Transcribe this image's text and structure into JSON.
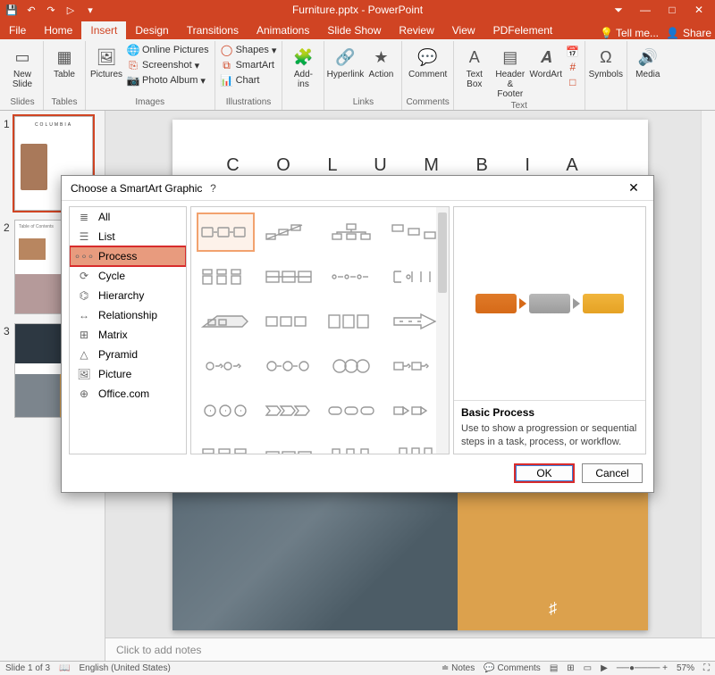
{
  "app": {
    "title": "Furniture.pptx - PowerPoint"
  },
  "tabs": {
    "file": "File",
    "home": "Home",
    "insert": "Insert",
    "design": "Design",
    "transitions": "Transitions",
    "animations": "Animations",
    "slideshow": "Slide Show",
    "review": "Review",
    "view": "View",
    "pdfelement": "PDFelement",
    "tellme": "Tell me...",
    "share": "Share"
  },
  "ribbon": {
    "newslide": "New\nSlide",
    "slides": "Slides",
    "table": "Table",
    "tables": "Tables",
    "pictures": "Pictures",
    "onlinepics": "Online Pictures",
    "screenshot": "Screenshot",
    "photoalbum": "Photo Album",
    "images": "Images",
    "shapes": "Shapes",
    "smartart": "SmartArt",
    "chart": "Chart",
    "illustrations": "Illustrations",
    "addins": "Add-\nins",
    "hyperlink": "Hyperlink",
    "action": "Action",
    "links": "Links",
    "comment": "Comment",
    "comments": "Comments",
    "textbox": "Text\nBox",
    "headerfooter": "Header\n& Footer",
    "wordart": "WordArt",
    "text": "Text",
    "symbols": "Symbols",
    "media": "Media"
  },
  "thumbnails": {
    "n1": "1",
    "n2": "2",
    "n3": "3"
  },
  "slide": {
    "title": "C O L U M B I A"
  },
  "notes": {
    "placeholder": "Click to add notes"
  },
  "dialog": {
    "title": "Choose a SmartArt Graphic",
    "categories": {
      "all": "All",
      "list": "List",
      "process": "Process",
      "cycle": "Cycle",
      "hierarchy": "Hierarchy",
      "relationship": "Relationship",
      "matrix": "Matrix",
      "pyramid": "Pyramid",
      "picture": "Picture",
      "office": "Office.com"
    },
    "preview": {
      "name": "Basic Process",
      "desc": "Use to show a progression or sequential steps in a task, process, or workflow."
    },
    "ok": "OK",
    "cancel": "Cancel"
  },
  "status": {
    "slidecount": "Slide 1 of 3",
    "lang": "English (United States)",
    "notes": "Notes",
    "comments": "Comments",
    "zoom": "57%"
  }
}
